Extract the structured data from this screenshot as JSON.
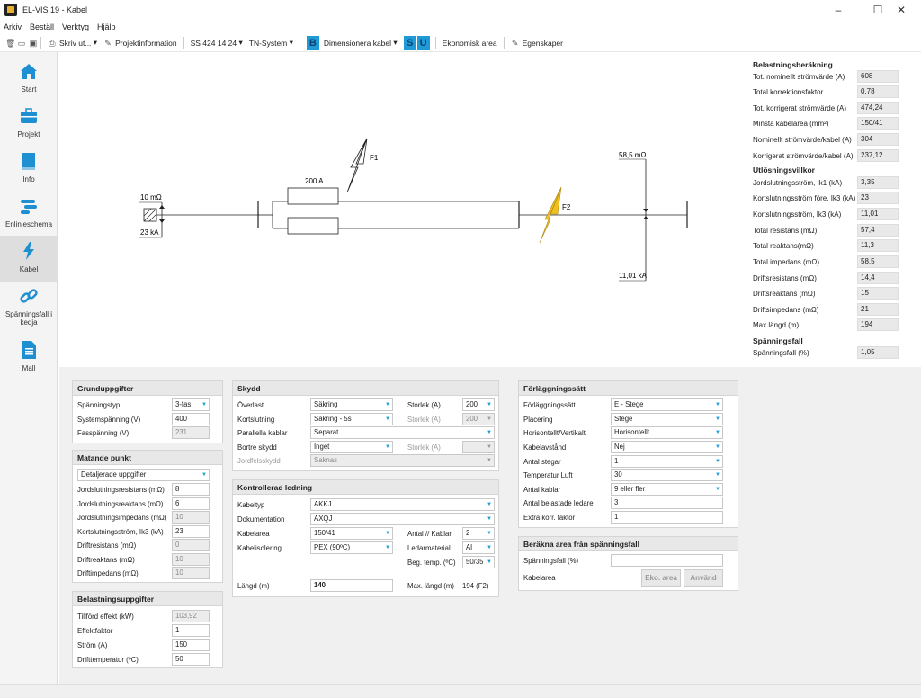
{
  "window": {
    "title": "EL-VIS 19 - Kabel",
    "minimize": "–",
    "maximize": "☐",
    "close": "✕"
  },
  "menu": [
    "Arkiv",
    "Beställ",
    "Verktyg",
    "Hjälp"
  ],
  "toolbar": {
    "print": "Skriv ut...",
    "project_info": "Projektinformation",
    "standard": "SS 424 14 24",
    "system": "TN-System",
    "b_btn": "B",
    "dimension": "Dimensionera kabel",
    "s_btn": "S",
    "u_btn": "U",
    "economic": "Ekonomisk area",
    "properties": "Egenskaper"
  },
  "sidebar": [
    {
      "label": "Start",
      "icon": "home-icon"
    },
    {
      "label": "Projekt",
      "icon": "briefcase-icon"
    },
    {
      "label": "Info",
      "icon": "book-icon"
    },
    {
      "label": "Enlinjeschema",
      "icon": "schema-icon"
    },
    {
      "label": "Kabel",
      "icon": "lightning-icon"
    },
    {
      "label": "Spänningsfall i kedja",
      "icon": "chain-icon"
    },
    {
      "label": "Mall",
      "icon": "document-icon"
    }
  ],
  "diagram": {
    "source_impedance": "10 mΩ",
    "source_current": "23 kA",
    "fuse_rating": "200 A",
    "f1": "F1",
    "f2": "F2",
    "end_impedance": "58,5 mΩ",
    "end_current": "11,01 kA"
  },
  "calc": {
    "heading1": "Belastningsberäkning",
    "rows1": [
      {
        "label": "Tot. nominellt strömvärde (A)",
        "value": "608"
      },
      {
        "label": "Total korrektionsfaktor",
        "value": "0,78"
      },
      {
        "label": "Tot. korrigerat strömvärde (A)",
        "value": "474,24"
      },
      {
        "label": "Minsta kabelarea (mm²)",
        "value": "150/41"
      },
      {
        "label": "Nominellt strömvärde/kabel (A)",
        "value": "304"
      },
      {
        "label": "Korrigerat strömvärde/kabel (A)",
        "value": "237,12"
      }
    ],
    "heading2": "Utlösningsvillkor",
    "rows2": [
      {
        "label": "Jordslutningsström, Ik1 (kA)",
        "value": "3,35"
      },
      {
        "label": "Kortslutningsström före, Ik3 (kA)",
        "value": "23"
      },
      {
        "label": "Kortslutningsström, Ik3 (kA)",
        "value": "11,01"
      },
      {
        "label": "Total resistans (mΩ)",
        "value": "57,4"
      },
      {
        "label": "Total reaktans(mΩ)",
        "value": "11,3"
      },
      {
        "label": "Total impedans (mΩ)",
        "value": "58,5"
      },
      {
        "label": "Driftsresistans (mΩ)",
        "value": "14,4"
      },
      {
        "label": "Driftsreaktans (mΩ)",
        "value": "15"
      },
      {
        "label": "Driftsimpedans (mΩ)",
        "value": "21"
      },
      {
        "label": "Max längd (m)",
        "value": "194"
      }
    ],
    "heading3": "Spänningsfall",
    "rows3": [
      {
        "label": "Spänningsfall (%)",
        "value": "1,05"
      }
    ]
  },
  "grund": {
    "title": "Grunduppgifter",
    "spanningstyp_label": "Spänningstyp",
    "spanningstyp": "3-fas",
    "systemspanning_label": "Systemspänning (V)",
    "systemspanning": "400",
    "fasspanning_label": "Fasspänning (V)",
    "fasspanning": "231"
  },
  "matande": {
    "title": "Matande punkt",
    "mode": "Detaljerade uppgifter",
    "rows": [
      {
        "label": "Jordslutningsresistans (mΩ)",
        "value": "8",
        "ro": false
      },
      {
        "label": "Jordslutningsreaktans (mΩ)",
        "value": "6",
        "ro": false
      },
      {
        "label": "Jordslutningsimpedans (mΩ)",
        "value": "10",
        "ro": true
      },
      {
        "label": "Kortslutningsström, Ik3 (kA)",
        "value": "23",
        "ro": false
      },
      {
        "label": "Driftresistans (mΩ)",
        "value": "0",
        "ro": true
      },
      {
        "label": "Driftreaktans (mΩ)",
        "value": "10",
        "ro": true
      },
      {
        "label": "Driftimpedans (mΩ)",
        "value": "10",
        "ro": true
      }
    ]
  },
  "belastning": {
    "title": "Belastningsuppgifter",
    "rows": [
      {
        "label": "Tillförd effekt (kW)",
        "value": "103,92",
        "ro": true
      },
      {
        "label": "Effektfaktor",
        "value": "1",
        "ro": false
      },
      {
        "label": "Ström (A)",
        "value": "150",
        "ro": false
      },
      {
        "label": "Drifttemperatur (ºC)",
        "value": "50",
        "ro": false
      }
    ]
  },
  "skydd": {
    "title": "Skydd",
    "overlast_label": "Överlast",
    "overlast": "Säkring",
    "storlek1_label": "Storlek (A)",
    "storlek1": "200",
    "kortslutning_label": "Kortslutning",
    "kortslutning": "Säkring - 5s",
    "storlek2_label": "Storlek (A)",
    "storlek2": "200",
    "parallella_label": "Parallella kablar",
    "parallella": "Separat",
    "bortre_label": "Bortre skydd",
    "bortre": "Inget",
    "storlek3_label": "Storlek (A)",
    "storlek3": "",
    "jordfel_label": "Jordfelsskydd",
    "jordfel": "Saknas"
  },
  "ledning": {
    "title": "Kontrollerad ledning",
    "kabeltyp_label": "Kabeltyp",
    "kabeltyp": "AKKJ",
    "dok_label": "Dokumentation",
    "dok": "AXQJ",
    "area_label": "Kabelarea",
    "area": "150/41",
    "antal_label": "Antal // Kablar",
    "antal": "2",
    "isolering_label": "Kabelisolering",
    "isolering": "PEX (90ºC)",
    "ledarmaterial_label": "Ledarmaterial",
    "ledarmaterial": "Al",
    "begtemp_label": "Beg. temp. (ºC)",
    "begtemp": "50/35",
    "langd_label": "Längd (m)",
    "langd": "140",
    "maxlangd_label": "Max. längd (m)",
    "maxlangd": "194 (F2)"
  },
  "forlaggning": {
    "title": "Förläggningssätt",
    "rows": [
      {
        "label": "Förläggningssätt",
        "value": "E - Stege",
        "type": "dd"
      },
      {
        "label": "Placering",
        "value": "Stege",
        "type": "dd"
      },
      {
        "label": "Horisontellt/Vertikalt",
        "value": "Horisontellt",
        "type": "dd"
      },
      {
        "label": "Kabelavstånd",
        "value": "Nej",
        "type": "dd"
      },
      {
        "label": "Antal stegar",
        "value": "1",
        "type": "dd"
      },
      {
        "label": "Temperatur Luft",
        "value": "30",
        "type": "dd"
      },
      {
        "label": "Antal kablar",
        "value": "9 eller fler",
        "type": "dd"
      },
      {
        "label": "Antal belastade ledare",
        "value": "3",
        "type": "inp"
      },
      {
        "label": "Extra korr. faktor",
        "value": "1",
        "type": "inp"
      }
    ]
  },
  "berakna": {
    "title": "Beräkna area från spänningsfall",
    "spf_label": "Spänningsfall (%)",
    "spf": "",
    "area_label": "Kabelarea",
    "eko_btn": "Eko. area",
    "anvand_btn": "Använd"
  }
}
